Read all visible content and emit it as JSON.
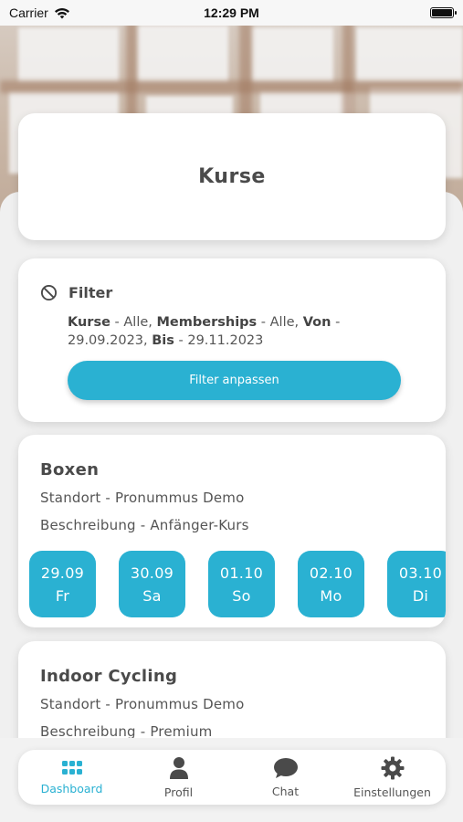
{
  "status_bar": {
    "carrier": "Carrier",
    "time": "12:29 PM"
  },
  "page": {
    "title": "Kurse"
  },
  "filter": {
    "title": "Filter",
    "kurse_label": "Kurse",
    "kurse_value": " - Alle, ",
    "memberships_label": "Memberships",
    "memberships_value": " - Alle, ",
    "von_label": "Von",
    "von_value": " - 29.09.2023, ",
    "bis_label": "Bis",
    "bis_value": " - 29.11.2023",
    "button_label": "Filter anpassen"
  },
  "courses": [
    {
      "name": "Boxen",
      "standort": "Standort - Pronummus Demo",
      "beschreibung": "Beschreibung - Anfänger-Kurs",
      "dates": [
        {
          "date": "29.09",
          "day": "Fr"
        },
        {
          "date": "30.09",
          "day": "Sa"
        },
        {
          "date": "01.10",
          "day": "So"
        },
        {
          "date": "02.10",
          "day": "Mo"
        },
        {
          "date": "03.10",
          "day": "Di"
        }
      ]
    },
    {
      "name": "Indoor Cycling",
      "standort": "Standort - Pronummus Demo",
      "beschreibung": "Beschreibung - Premium"
    }
  ],
  "tabbar": {
    "active_tab": "Dashboard",
    "tabs": [
      {
        "label": "Dashboard",
        "icon": "grid-icon"
      },
      {
        "label": "Profil",
        "icon": "person-icon"
      },
      {
        "label": "Chat",
        "icon": "chat-bubble-icon"
      },
      {
        "label": "Einstellungen",
        "icon": "gear-icon"
      }
    ]
  },
  "colors": {
    "accent": "#2ab1d2",
    "card": "#ffffff",
    "background": "#f0f0f0",
    "text": "#4a4a4a"
  }
}
